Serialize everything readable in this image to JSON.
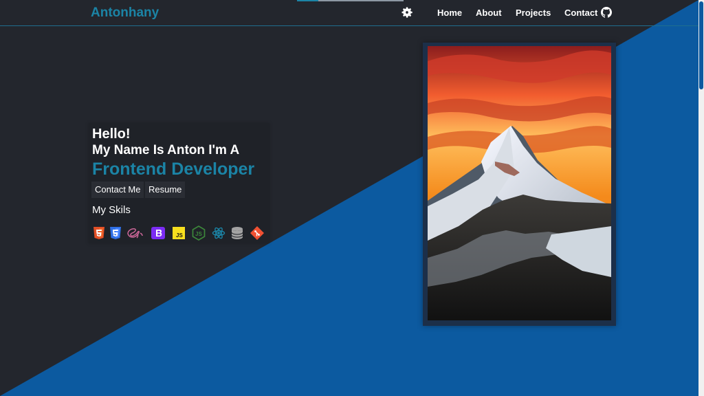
{
  "nav": {
    "brand": "Antonhany",
    "links": [
      "Home",
      "About",
      "Projects",
      "Contact"
    ],
    "theme_toggle": "gear-icon",
    "github": "github-icon"
  },
  "hero": {
    "hello": "Hello!",
    "intro": "My Name Is Anton I'm A",
    "role": "Frontend Developer",
    "buttons": [
      "Contact Me",
      "Resume"
    ],
    "skills_label": "My Skils",
    "skills": [
      "html5-icon",
      "css3-icon",
      "sass-icon",
      "bootstrap-icon",
      "javascript-icon",
      "nodejs-icon",
      "react-icon",
      "database-icon",
      "git-icon"
    ]
  },
  "colors": {
    "background": "#23262d",
    "accent": "#1b84a6",
    "blue_panel": "#0c5aa0",
    "text": "#ffffff"
  }
}
